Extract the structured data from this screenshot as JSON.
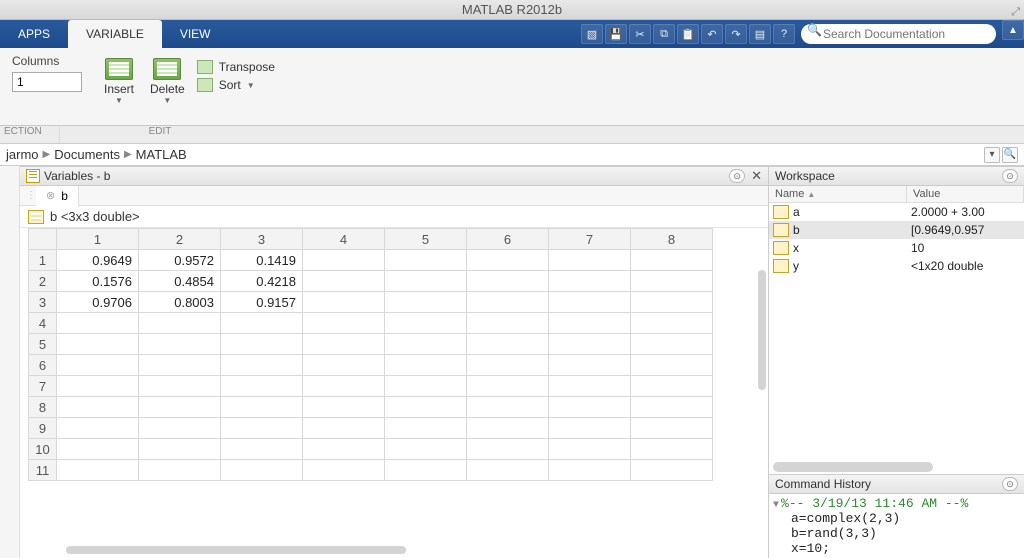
{
  "title": "MATLAB R2012b",
  "ribbon": {
    "tabs": {
      "apps": "APPS",
      "variable": "VARIABLE",
      "view": "VIEW"
    },
    "search_placeholder": "Search Documentation"
  },
  "toolstrip": {
    "columns_label": "Columns",
    "columns_value": "1",
    "insert": "Insert",
    "delete": "Delete",
    "transpose": "Transpose",
    "sort": "Sort",
    "section_selection": "ECTION",
    "section_edit": "EDIT"
  },
  "breadcrumb": [
    "jarmo",
    "Documents",
    "MATLAB"
  ],
  "varpanel": {
    "title": "Variables - b",
    "tab": "b",
    "header": "b <3x3 double>",
    "cols": [
      "1",
      "2",
      "3",
      "4",
      "5",
      "6",
      "7",
      "8"
    ],
    "rows": [
      "1",
      "2",
      "3",
      "4",
      "5",
      "6",
      "7",
      "8",
      "9",
      "10",
      "11"
    ],
    "data": [
      [
        "0.9649",
        "0.9572",
        "0.1419",
        "",
        "",
        "",
        "",
        ""
      ],
      [
        "0.1576",
        "0.4854",
        "0.4218",
        "",
        "",
        "",
        "",
        ""
      ],
      [
        "0.9706",
        "0.8003",
        "0.9157",
        "",
        "",
        "",
        "",
        ""
      ],
      [
        "",
        "",
        "",
        "",
        "",
        "",
        "",
        ""
      ],
      [
        "",
        "",
        "",
        "",
        "",
        "",
        "",
        ""
      ],
      [
        "",
        "",
        "",
        "",
        "",
        "",
        "",
        ""
      ],
      [
        "",
        "",
        "",
        "",
        "",
        "",
        "",
        ""
      ],
      [
        "",
        "",
        "",
        "",
        "",
        "",
        "",
        ""
      ],
      [
        "",
        "",
        "",
        "",
        "",
        "",
        "",
        ""
      ],
      [
        "",
        "",
        "",
        "",
        "",
        "",
        "",
        ""
      ],
      [
        "",
        "",
        "",
        "",
        "",
        "",
        "",
        ""
      ]
    ]
  },
  "workspace": {
    "title": "Workspace",
    "col_name": "Name",
    "col_value": "Value",
    "vars": [
      {
        "name": "a",
        "value": "2.0000 + 3.00",
        "sel": false
      },
      {
        "name": "b",
        "value": "[0.9649,0.957",
        "sel": true
      },
      {
        "name": "x",
        "value": "10",
        "sel": false
      },
      {
        "name": "y",
        "value": "<1x20 double",
        "sel": false
      }
    ]
  },
  "history": {
    "title": "Command History",
    "timestamp": "%-- 3/19/13 11:46 AM --%",
    "lines": [
      "a=complex(2,3)",
      "b=rand(3,3)",
      "x=10;"
    ]
  }
}
